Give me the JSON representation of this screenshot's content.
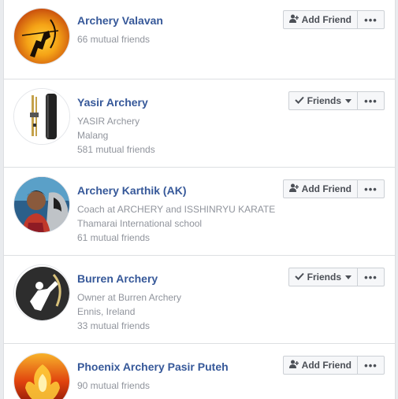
{
  "people": [
    {
      "name": "Archery Valavan",
      "lines": [
        "66 mutual friends"
      ],
      "action": "Add Friend",
      "action_icon": "add-friend-icon",
      "more": "•••"
    },
    {
      "name": "Yasir Archery",
      "lines": [
        "YASIR Archery",
        "Malang",
        "581 mutual friends"
      ],
      "action": "Friends",
      "action_icon": "checkmark-icon",
      "more": "•••"
    },
    {
      "name": "Archery Karthik (AK)",
      "lines": [
        "Coach at ARCHERY and ISSHINRYU KARATE",
        "Thamarai International school",
        "61 mutual friends"
      ],
      "action": "Add Friend",
      "action_icon": "add-friend-icon",
      "more": "•••"
    },
    {
      "name": "Burren Archery",
      "lines": [
        "Owner at Burren Archery",
        "Ennis, Ireland",
        "33 mutual friends"
      ],
      "action": "Friends",
      "action_icon": "checkmark-icon",
      "more": "•••"
    },
    {
      "name": "Phoenix Archery Pasir Puteh",
      "lines": [
        "90 mutual friends"
      ],
      "action": "Add Friend",
      "action_icon": "add-friend-icon",
      "more": "•••"
    }
  ],
  "colors": {
    "name_link": "#365899",
    "secondary_text": "#90949c",
    "button_bg": "#f6f7f9",
    "border": "#dddfe2"
  }
}
